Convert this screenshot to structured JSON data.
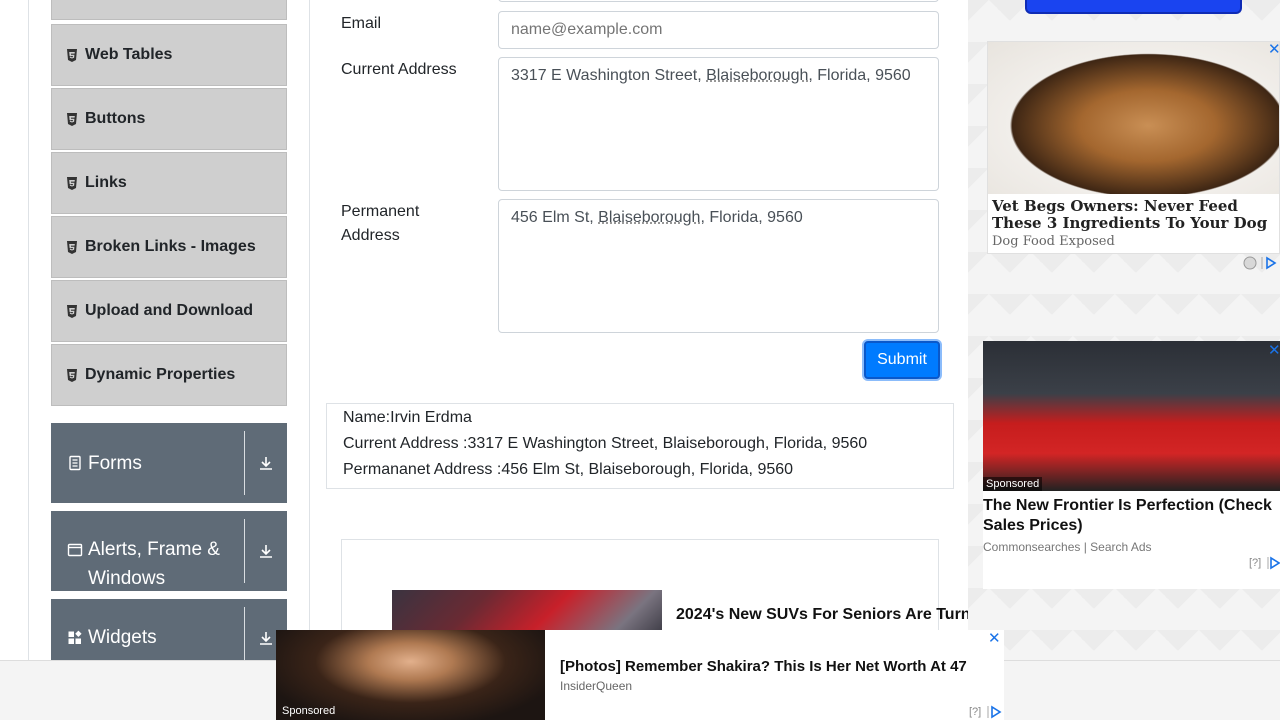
{
  "sidebar": {
    "items": [
      {
        "label": ""
      },
      {
        "label": "Web Tables"
      },
      {
        "label": "Buttons"
      },
      {
        "label": "Links"
      },
      {
        "label": "Broken Links - Images"
      },
      {
        "label": "Upload and Download"
      },
      {
        "label": "Dynamic Properties"
      }
    ],
    "groups": [
      {
        "label": "Forms",
        "icon": "document-icon"
      },
      {
        "label": "Alerts, Frame & Windows",
        "icon": "window-icon"
      },
      {
        "label": "Widgets",
        "icon": "widgets-icon"
      }
    ]
  },
  "form": {
    "email_label": "Email",
    "email_placeholder": "name@example.com",
    "current_address_label": "Current Address",
    "current_address": {
      "pre": "3317 E Washington Street, ",
      "flagged": "Blaiseborough",
      "post": ", Florida, 9560"
    },
    "permanent_address_label": "Permanent Address",
    "permanent_address": {
      "pre": "456 Elm St, ",
      "flagged": "Blaiseborough",
      "post": ", Florida, 9560"
    },
    "submit_label": "Submit"
  },
  "output": {
    "name": "Name:Irvin Erdma",
    "current_address": "Current Address :3317 E Washington Street, Blaiseborough, Florida, 9560",
    "permanent_address": "Permananet Address :456 Elm St, Blaiseborough, Florida, 9560"
  },
  "ads": {
    "native_inline_title": "2024's New SUVs For Seniors Are Turn",
    "right_top": {
      "title": "Vet Begs Owners: Never Feed These 3 Ingredients To Your Dog",
      "source": "Dog Food Exposed"
    },
    "right_bottom": {
      "title": "The New Frontier Is Perfection (Check Sales Prices)",
      "source": "Commonsearches | Search Ads",
      "sponsored": "Sponsored",
      "help": "[?]"
    },
    "bottom": {
      "title": "[Photos] Remember Shakira? This Is Her Net Worth At 47",
      "source": "InsiderQueen",
      "sponsored": "Sponsored",
      "help": "[?]"
    },
    "close_glyph": "✕"
  }
}
